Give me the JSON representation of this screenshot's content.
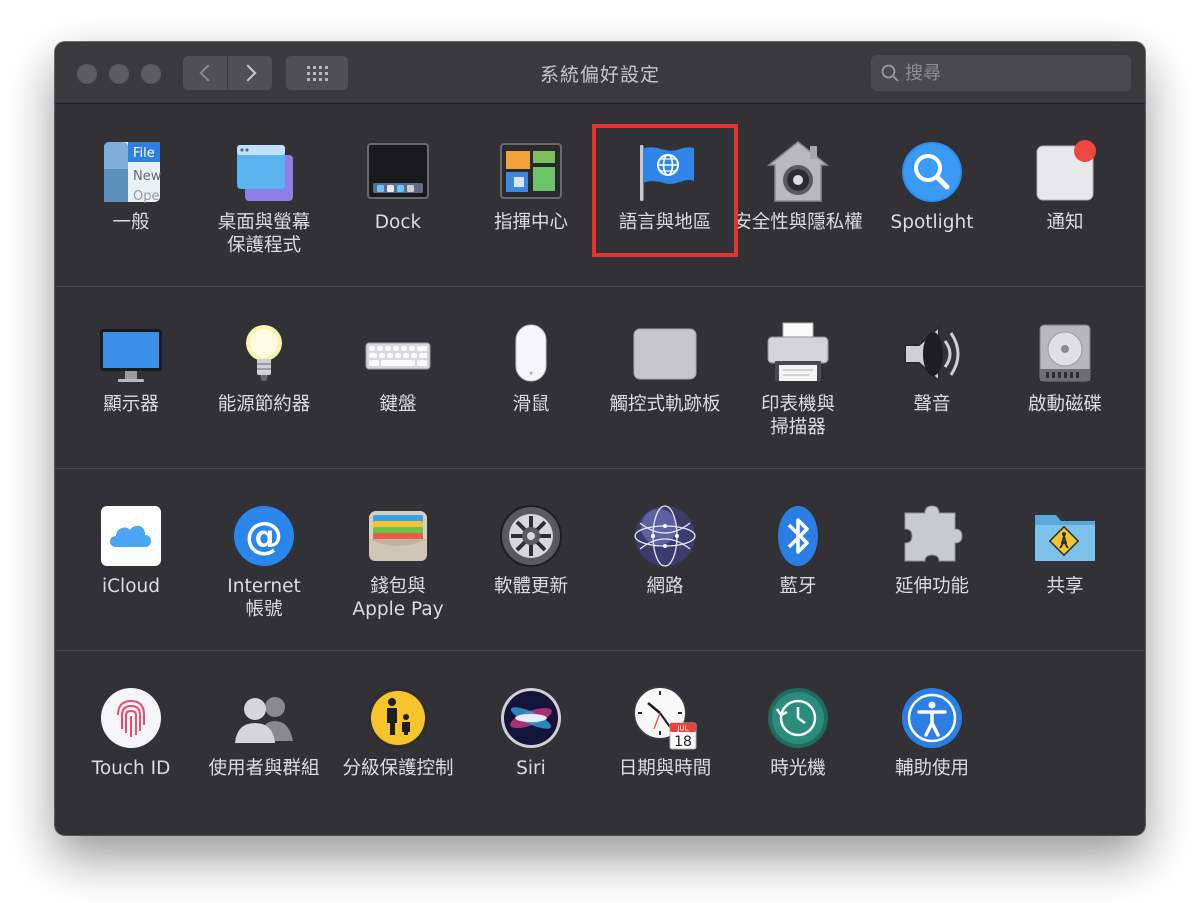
{
  "window": {
    "title": "系統偏好設定"
  },
  "search": {
    "placeholder": "搜尋"
  },
  "rows": [
    [
      {
        "label": "一般",
        "icon": "general-icon",
        "icon_text": [
          "File",
          "New",
          "Ope"
        ]
      },
      {
        "label": "桌面與螢幕\n保護程式",
        "icon": "desktop-screensaver-icon"
      },
      {
        "label": "Dock",
        "icon": "dock-icon"
      },
      {
        "label": "指揮中心",
        "icon": "mission-control-icon"
      },
      {
        "label": "語言與地區",
        "icon": "language-region-icon"
      },
      {
        "label": "安全性與隱私權",
        "icon": "security-privacy-icon"
      },
      {
        "label": "Spotlight",
        "icon": "spotlight-icon"
      },
      {
        "label": "通知",
        "icon": "notifications-icon"
      }
    ],
    [
      {
        "label": "顯示器",
        "icon": "displays-icon"
      },
      {
        "label": "能源節約器",
        "icon": "energy-saver-icon"
      },
      {
        "label": "鍵盤",
        "icon": "keyboard-icon"
      },
      {
        "label": "滑鼠",
        "icon": "mouse-icon"
      },
      {
        "label": "觸控式軌跡板",
        "icon": "trackpad-icon"
      },
      {
        "label": "印表機與\n掃描器",
        "icon": "printers-scanners-icon"
      },
      {
        "label": "聲音",
        "icon": "sound-icon"
      },
      {
        "label": "啟動磁碟",
        "icon": "startup-disk-icon"
      }
    ],
    [
      {
        "label": "iCloud",
        "icon": "icloud-icon"
      },
      {
        "label": "Internet\n帳號",
        "icon": "internet-accounts-icon"
      },
      {
        "label": "錢包與\nApple Pay",
        "icon": "wallet-applepay-icon"
      },
      {
        "label": "軟體更新",
        "icon": "software-update-icon"
      },
      {
        "label": "網路",
        "icon": "network-icon"
      },
      {
        "label": "藍牙",
        "icon": "bluetooth-icon"
      },
      {
        "label": "延伸功能",
        "icon": "extensions-icon"
      },
      {
        "label": "共享",
        "icon": "sharing-icon"
      }
    ],
    [
      {
        "label": "Touch ID",
        "icon": "touch-id-icon"
      },
      {
        "label": "使用者與群組",
        "icon": "users-groups-icon"
      },
      {
        "label": "分級保護控制",
        "icon": "parental-controls-icon"
      },
      {
        "label": "Siri",
        "icon": "siri-icon"
      },
      {
        "label": "日期與時間",
        "icon": "date-time-icon",
        "icon_text": [
          "JUL",
          "18"
        ]
      },
      {
        "label": "時光機",
        "icon": "time-machine-icon"
      },
      {
        "label": "輔助使用",
        "icon": "accessibility-icon"
      }
    ]
  ],
  "highlighted_pane": "語言與地區",
  "colors": {
    "window_bg": "#323236",
    "highlight_border": "#e3342f",
    "label_text": "#dcdcdf"
  }
}
